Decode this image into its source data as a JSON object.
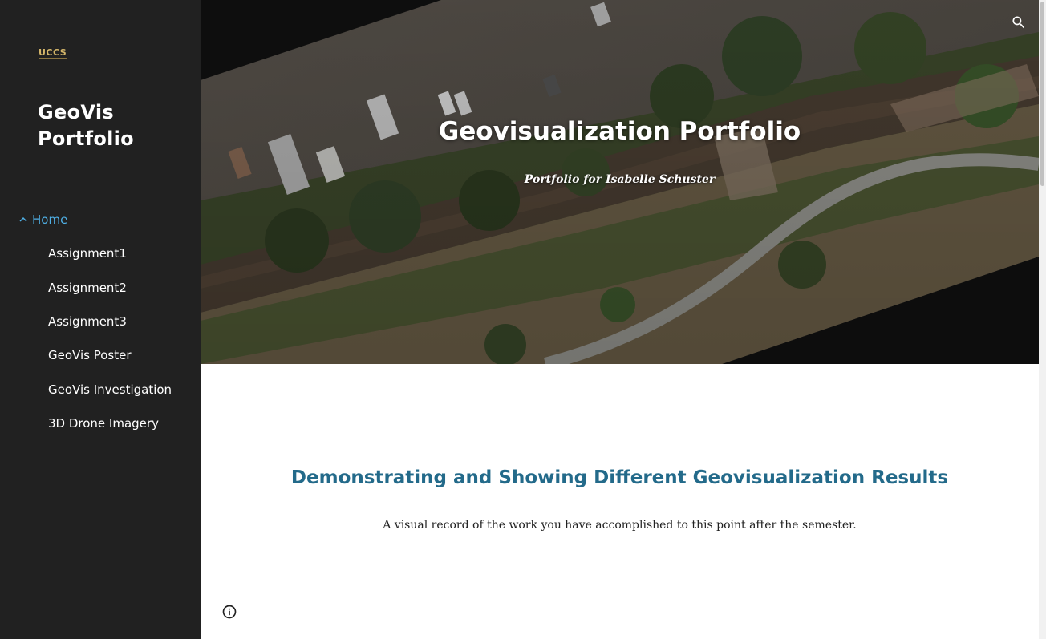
{
  "sidebar": {
    "logo_text": "UCCS",
    "site_title": "GeoVis Portfolio",
    "home_label": "Home",
    "items": [
      {
        "label": "Assignment1"
      },
      {
        "label": "Assignment2"
      },
      {
        "label": "Assignment3"
      },
      {
        "label": "GeoVis Poster"
      },
      {
        "label": "GeoVis Investigation"
      },
      {
        "label": "3D Drone Imagery"
      }
    ]
  },
  "hero": {
    "title": "Geovisualization Portfolio",
    "subtitle": "Portfolio for Isabelle Schuster"
  },
  "main": {
    "heading": "Demonstrating and Showing Different Geovisualization Results",
    "text": "A visual record of the work you have accomplished to this point after the semester."
  },
  "icons": {
    "search": "search-icon",
    "collapse": "chevron-up-icon",
    "info": "info-icon"
  },
  "colors": {
    "sidebar_bg": "#212121",
    "nav_active": "#4fb0e6",
    "heading": "#236a8a"
  }
}
